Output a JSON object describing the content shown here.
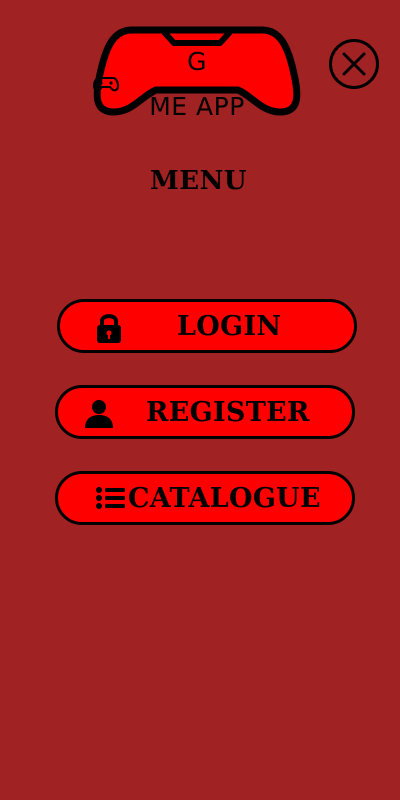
{
  "header": {
    "logo_text": "G●ME APP",
    "logo_icon": "gamepad-icon",
    "close_icon": "close-icon"
  },
  "menu": {
    "title": "MENU",
    "items": [
      {
        "label": "LOGIN",
        "icon": "lock-icon"
      },
      {
        "label": "REGISTER",
        "icon": "user-icon"
      },
      {
        "label": "CATALOGUE",
        "icon": "list-icon"
      }
    ]
  },
  "colors": {
    "background": "#a12222",
    "accent": "#ff0000",
    "outline": "#000000"
  }
}
